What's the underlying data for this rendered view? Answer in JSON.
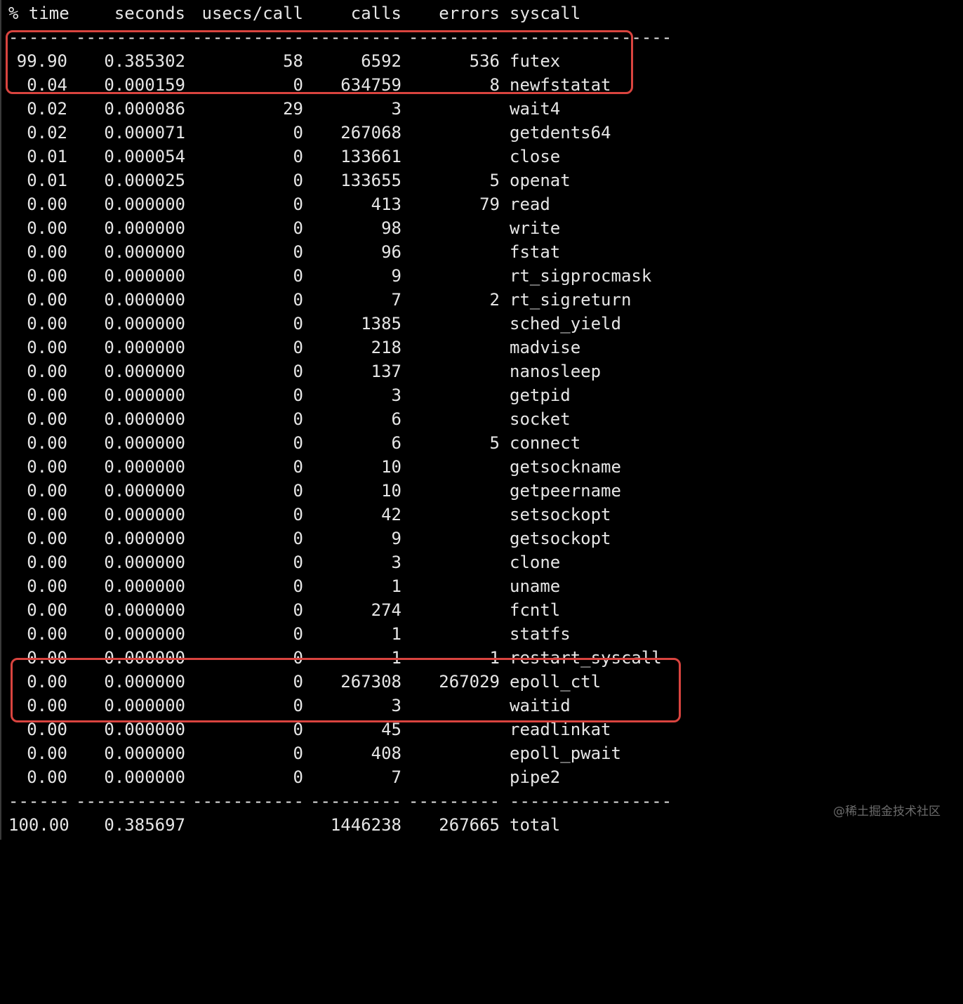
{
  "colors": {
    "background": "#000000",
    "text": "#e6e6e6",
    "highlight": "#d9443f",
    "watermark": "#6b6b6b"
  },
  "header": {
    "pct_time": "% time",
    "seconds": "seconds",
    "usecs_call": "usecs/call",
    "calls": "calls",
    "errors": "errors",
    "syscall": "syscall"
  },
  "separator": {
    "pct_time": "------",
    "seconds": "-----------",
    "usecs_call": "-----------",
    "calls": "---------",
    "errors": "---------",
    "syscall": "----------------"
  },
  "rows": [
    {
      "pct": "99.90",
      "seconds": "0.385302",
      "usecs": "58",
      "calls": "6592",
      "errors": "536",
      "syscall": "futex"
    },
    {
      "pct": "0.04",
      "seconds": "0.000159",
      "usecs": "0",
      "calls": "634759",
      "errors": "8",
      "syscall": "newfstatat"
    },
    {
      "pct": "0.02",
      "seconds": "0.000086",
      "usecs": "29",
      "calls": "3",
      "errors": "",
      "syscall": "wait4"
    },
    {
      "pct": "0.02",
      "seconds": "0.000071",
      "usecs": "0",
      "calls": "267068",
      "errors": "",
      "syscall": "getdents64"
    },
    {
      "pct": "0.01",
      "seconds": "0.000054",
      "usecs": "0",
      "calls": "133661",
      "errors": "",
      "syscall": "close"
    },
    {
      "pct": "0.01",
      "seconds": "0.000025",
      "usecs": "0",
      "calls": "133655",
      "errors": "5",
      "syscall": "openat"
    },
    {
      "pct": "0.00",
      "seconds": "0.000000",
      "usecs": "0",
      "calls": "413",
      "errors": "79",
      "syscall": "read"
    },
    {
      "pct": "0.00",
      "seconds": "0.000000",
      "usecs": "0",
      "calls": "98",
      "errors": "",
      "syscall": "write"
    },
    {
      "pct": "0.00",
      "seconds": "0.000000",
      "usecs": "0",
      "calls": "96",
      "errors": "",
      "syscall": "fstat"
    },
    {
      "pct": "0.00",
      "seconds": "0.000000",
      "usecs": "0",
      "calls": "9",
      "errors": "",
      "syscall": "rt_sigprocmask"
    },
    {
      "pct": "0.00",
      "seconds": "0.000000",
      "usecs": "0",
      "calls": "7",
      "errors": "2",
      "syscall": "rt_sigreturn"
    },
    {
      "pct": "0.00",
      "seconds": "0.000000",
      "usecs": "0",
      "calls": "1385",
      "errors": "",
      "syscall": "sched_yield"
    },
    {
      "pct": "0.00",
      "seconds": "0.000000",
      "usecs": "0",
      "calls": "218",
      "errors": "",
      "syscall": "madvise"
    },
    {
      "pct": "0.00",
      "seconds": "0.000000",
      "usecs": "0",
      "calls": "137",
      "errors": "",
      "syscall": "nanosleep"
    },
    {
      "pct": "0.00",
      "seconds": "0.000000",
      "usecs": "0",
      "calls": "3",
      "errors": "",
      "syscall": "getpid"
    },
    {
      "pct": "0.00",
      "seconds": "0.000000",
      "usecs": "0",
      "calls": "6",
      "errors": "",
      "syscall": "socket"
    },
    {
      "pct": "0.00",
      "seconds": "0.000000",
      "usecs": "0",
      "calls": "6",
      "errors": "5",
      "syscall": "connect"
    },
    {
      "pct": "0.00",
      "seconds": "0.000000",
      "usecs": "0",
      "calls": "10",
      "errors": "",
      "syscall": "getsockname"
    },
    {
      "pct": "0.00",
      "seconds": "0.000000",
      "usecs": "0",
      "calls": "10",
      "errors": "",
      "syscall": "getpeername"
    },
    {
      "pct": "0.00",
      "seconds": "0.000000",
      "usecs": "0",
      "calls": "42",
      "errors": "",
      "syscall": "setsockopt"
    },
    {
      "pct": "0.00",
      "seconds": "0.000000",
      "usecs": "0",
      "calls": "9",
      "errors": "",
      "syscall": "getsockopt"
    },
    {
      "pct": "0.00",
      "seconds": "0.000000",
      "usecs": "0",
      "calls": "3",
      "errors": "",
      "syscall": "clone"
    },
    {
      "pct": "0.00",
      "seconds": "0.000000",
      "usecs": "0",
      "calls": "1",
      "errors": "",
      "syscall": "uname"
    },
    {
      "pct": "0.00",
      "seconds": "0.000000",
      "usecs": "0",
      "calls": "274",
      "errors": "",
      "syscall": "fcntl"
    },
    {
      "pct": "0.00",
      "seconds": "0.000000",
      "usecs": "0",
      "calls": "1",
      "errors": "",
      "syscall": "statfs"
    },
    {
      "pct": "0.00",
      "seconds": "0.000000",
      "usecs": "0",
      "calls": "1",
      "errors": "1",
      "syscall": "restart_syscall"
    },
    {
      "pct": "0.00",
      "seconds": "0.000000",
      "usecs": "0",
      "calls": "267308",
      "errors": "267029",
      "syscall": "epoll_ctl"
    },
    {
      "pct": "0.00",
      "seconds": "0.000000",
      "usecs": "0",
      "calls": "3",
      "errors": "",
      "syscall": "waitid"
    },
    {
      "pct": "0.00",
      "seconds": "0.000000",
      "usecs": "0",
      "calls": "45",
      "errors": "",
      "syscall": "readlinkat"
    },
    {
      "pct": "0.00",
      "seconds": "0.000000",
      "usecs": "0",
      "calls": "408",
      "errors": "",
      "syscall": "epoll_pwait"
    },
    {
      "pct": "0.00",
      "seconds": "0.000000",
      "usecs": "0",
      "calls": "7",
      "errors": "",
      "syscall": "pipe2"
    }
  ],
  "total": {
    "pct": "100.00",
    "seconds": "0.385697",
    "usecs": "",
    "calls": "1446238",
    "errors": "267665",
    "syscall": "total"
  },
  "watermark": "@稀土掘金技术社区"
}
